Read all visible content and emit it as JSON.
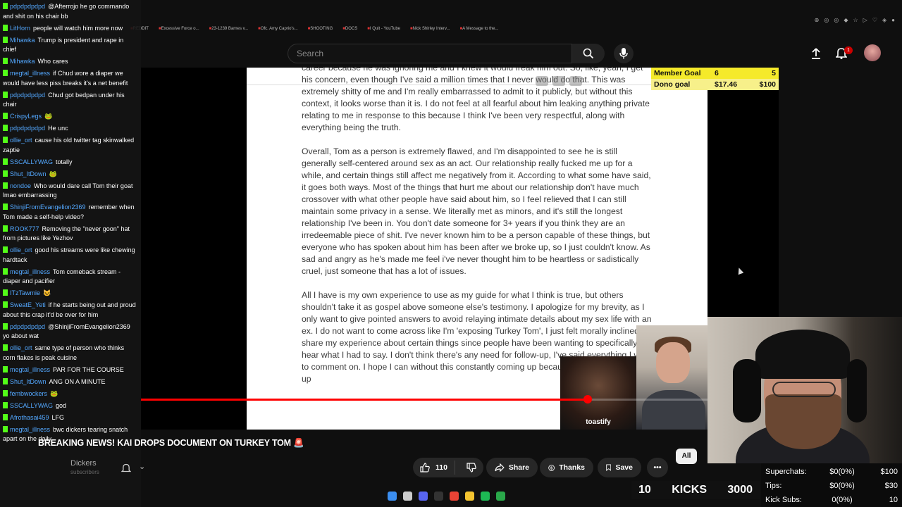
{
  "bookmarks": [
    "REDDIT",
    "Excessive Force o...",
    "23-1239 Barnes v...",
    "Ofc. Amy Caprio's...",
    "SHOOTING",
    "DOCS",
    "I Quit - YouTube",
    "Nick Shirley Interv...",
    "A Message to the..."
  ],
  "search": {
    "placeholder": "Search"
  },
  "notifications": {
    "count": "1"
  },
  "goals": {
    "member_label": "Member Goal",
    "member_current": "6",
    "member_target": "5",
    "dono_label": "Dono goal",
    "dono_current": "$17.46",
    "dono_target": "$100",
    "member_color": "#f5ea2a",
    "dono_color": "#f7f08a"
  },
  "document": {
    "paragraphs": [
      "career because he was ignoring me and I knew it would freak him out. So, like, yeah, I get his concern, even though I've said a million times that I never would do that. This was extremely shitty of me and I'm really embarrassed to admit to it publicly, but without this context, it looks worse than it is. I do not feel at all fearful about him leaking anything private relating to me in response to this because I think I've been very respectful, along with everything being the truth.",
      "Overall, Tom as a person is extremely flawed, and I'm disappointed to see he is still generally self-centered around sex as an act. Our relationship really fucked me up for a while, and certain things still affect me negatively from it. According to what some have said, it goes both ways. Most of the things that hurt me about our relationship don't have much crossover with what other people have said about him, so I feel relieved that I can still maintain some privacy in a sense. We literally met as minors, and it's still the longest relationship I've been in. You don't date someone for 3+ years if you think they are an irredeemable piece of shit. I've never known him to be a person capable of these things, but everyone who has spoken about him has been after we broke up, so I just couldn't know. As sad and angry as he's made me feel i've never thought him to be heartless or sadistically cruel, just someone that has a lot of issues.",
      "All I have is my own experience to use as my guide for what I think is true, but others shouldn't take it as gospel above someone else's testimony. I apologize for my brevity, as I only want to give pointed answers to avoid relaying intimate details about my sex life with an ex. I do not want to come across like I'm 'exposing Turkey Tom', I just felt morally inclined to share my experience about certain things since people have been wanting to specifically hear what I had to say. I don't think there's any need for follow-up, I've said everything I wish to comment on. I hope I can without this constantly coming up because we've been broken up"
    ]
  },
  "thumbnail": {
    "label": "toastify"
  },
  "playback": {
    "progress_fraction": 0.7
  },
  "chat": {
    "messages": [
      {
        "user": "pdpdpdpdpd",
        "text": "@Afterrojo he go commando and shit on his chair bb"
      },
      {
        "user": "LitHorn",
        "text": "people will watch him more now"
      },
      {
        "user": "Mihawka",
        "text": "Trump is president and rape in chief"
      },
      {
        "user": "Mihawka",
        "text": "Who cares"
      },
      {
        "user": "megtal_illness",
        "text": "if Chud wore a diaper we would have less piss breaks it's a net benefit"
      },
      {
        "user": "pdpdpdpdpd",
        "text": "Chud got bedpan under his chair"
      },
      {
        "user": "CrispyLegs",
        "text": "🐸"
      },
      {
        "user": "pdpdpdpdpd",
        "text": "He unc"
      },
      {
        "user": "ollie_ort",
        "text": "cause his old twitter tag skinwalked zaptie"
      },
      {
        "user": "SSCALLYWAG",
        "text": "totally"
      },
      {
        "user": "Shut_ItDown",
        "text": "🐸"
      },
      {
        "user": "nondoe",
        "text": "Who would dare call Tom their goat lmao embarrassing"
      },
      {
        "user": "ShinjiFromEvangelion2369",
        "text": "remember when Tom made a self-help video?"
      },
      {
        "user": "ROOK777",
        "text": "Removing the \"never goon\" hat from pictures like Yezhov"
      },
      {
        "user": "ollie_ort",
        "text": "good his streams were like chewing hardtack"
      },
      {
        "user": "megtal_illness",
        "text": "Tom comeback stream - diaper and pacifier"
      },
      {
        "user": "ITzTawmie",
        "text": "😺"
      },
      {
        "user": "SweatE_Yeti",
        "text": "if he starts being out and proud about this crap it'd be over for him"
      },
      {
        "user": "pdpdpdpdpd",
        "text": "@ShinjiFromEvangelion2369 yo about wat"
      },
      {
        "user": "ollie_ort",
        "text": "same type of person who thinks corn flakes is peak cuisine"
      },
      {
        "user": "megtal_illness",
        "text": "PAR FOR THE COURSE"
      },
      {
        "user": "Shut_ItDown",
        "text": "ANG ON A MINUTE"
      },
      {
        "user": "fembwockers",
        "text": "🐸"
      },
      {
        "user": "SSCALLYWAG",
        "text": "god"
      },
      {
        "user": "Afrothasai459",
        "text": "LFG"
      },
      {
        "user": "megtal_illness",
        "text": "bwc dickers tearing snatch apart on the daily"
      }
    ]
  },
  "video": {
    "title": "BREAKING NEWS! KAI DROPS DOCUMENT ON TURKEY TOM 🚨",
    "channel": "Dickers",
    "subscribers": "subscribers"
  },
  "actions": {
    "likes": "110",
    "share": "Share",
    "thanks": "Thanks",
    "save": "Save",
    "chip": "All"
  },
  "kicks": {
    "left": "10",
    "label": "KICKS",
    "right": "3000"
  },
  "stats": [
    {
      "label": "Superchats:",
      "value": "$0(0%)",
      "goal": "$100"
    },
    {
      "label": "Tips:",
      "value": "$0(0%)",
      "goal": "$30"
    },
    {
      "label": "Kick Subs:",
      "value": "0(0%)",
      "goal": "10"
    }
  ],
  "colors": {
    "kick_green": "#53fc18",
    "username_blue": "#53a8ff",
    "progress_red": "#ff0000"
  },
  "taskbar_icons": [
    "windows-icon",
    "search-icon",
    "discord-icon",
    "obs-icon",
    "chrome-icon",
    "folder-icon",
    "spotify-icon",
    "app-icon"
  ]
}
